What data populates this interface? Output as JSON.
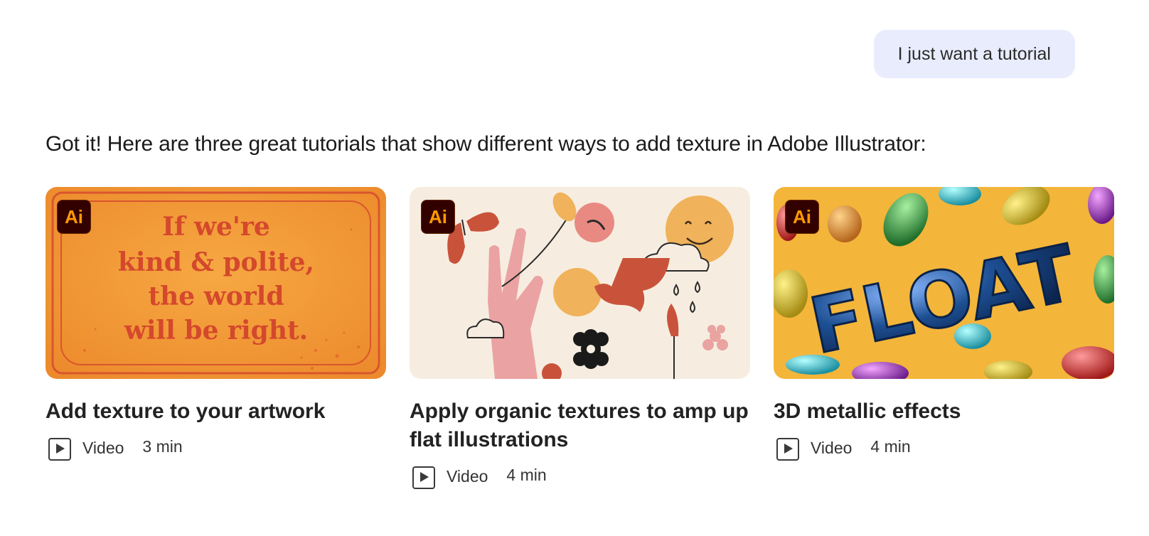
{
  "user_message": "I just want a tutorial",
  "assistant_intro": "Got it! Here are three great tutorials that show different ways to add texture in Adobe Illustrator:",
  "tutorials": [
    {
      "badge": "Ai",
      "title": "Add texture to your artwork",
      "type": "Video",
      "duration": "3 min",
      "thumbnail_text": [
        "If we're",
        "kind & polite,",
        "the world",
        "will be right."
      ],
      "thumbnail_colors": {
        "background": "#f2a03d",
        "text": "#d2452a"
      }
    },
    {
      "badge": "Ai",
      "title": "Apply organic textures to amp up flat illustrations",
      "type": "Video",
      "duration": "4 min",
      "thumbnail_colors": {
        "background": "#f6ede0",
        "accent": "#c9533a",
        "sun": "#f0b25a",
        "hand": "#eba2a2"
      }
    },
    {
      "badge": "Ai",
      "title": "3D metallic effects",
      "type": "Video",
      "duration": "4 min",
      "thumbnail_text": [
        "FLOAT"
      ],
      "thumbnail_colors": {
        "background": "#f3b53a",
        "letters": "#1d4f93"
      }
    }
  ],
  "colors": {
    "user_bubble": "#e9ecfd",
    "ai_badge_bg": "#330000",
    "ai_badge_text": "#ff9a00"
  },
  "icons": {
    "media_type": "video-play-icon",
    "app": "illustrator-icon"
  }
}
